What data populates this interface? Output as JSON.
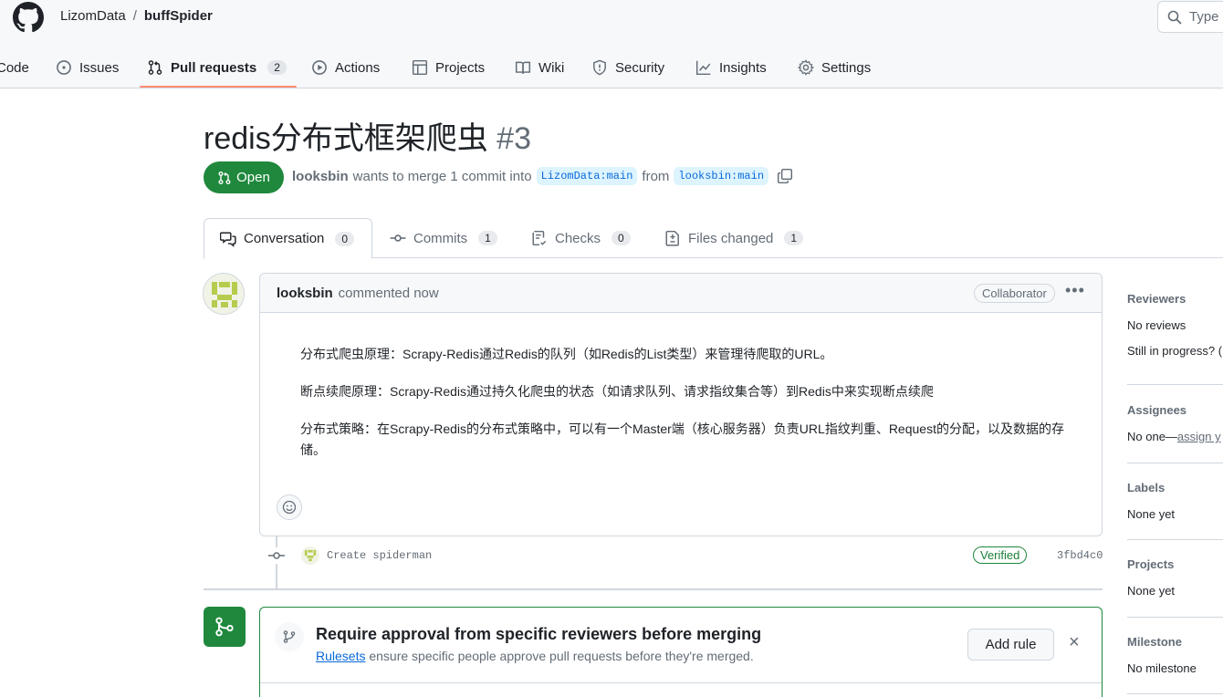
{
  "repo": {
    "owner": "LizomData",
    "separator": "/",
    "name": "buffSpider"
  },
  "search": {
    "placeholder": "Type"
  },
  "nav": {
    "code": "Code",
    "issues": "Issues",
    "pulls": "Pull requests",
    "pulls_count": "2",
    "actions": "Actions",
    "projects": "Projects",
    "wiki": "Wiki",
    "security": "Security",
    "insights": "Insights",
    "settings": "Settings"
  },
  "pr": {
    "title": "redis分布式框架爬虫",
    "number": "#3",
    "state": "Open",
    "author": "looksbin",
    "merge_text": "wants to merge 1 commit into",
    "base_branch": "LizomData:main",
    "from_text": "from",
    "head_branch": "looksbin:main"
  },
  "tabs": [
    {
      "label": "Conversation",
      "count": "0"
    },
    {
      "label": "Commits",
      "count": "1"
    },
    {
      "label": "Checks",
      "count": "0"
    },
    {
      "label": "Files changed",
      "count": "1"
    }
  ],
  "comment": {
    "author": "looksbin",
    "action": "commented now",
    "role": "Collaborator",
    "paragraphs": [
      "分布式爬虫原理：Scrapy-Redis通过Redis的队列（如Redis的List类型）来管理待爬取的URL。",
      "断点续爬原理：Scrapy-Redis通过持久化爬虫的状态（如请求队列、请求指纹集合等）到Redis中来实现断点续爬",
      "分布式策略：在Scrapy-Redis的分布式策略中，可以有一个Master端（核心服务器）负责URL指纹判重、Request的分配，以及数据的存储。"
    ]
  },
  "commit": {
    "message": "Create spiderman",
    "badge": "Verified",
    "sha": "3fbd4c0"
  },
  "merge_box": {
    "title": "Require approval from specific reviewers before merging",
    "desc_link": "Rulesets",
    "desc_rest": "ensure specific people approve pull requests before they're merged.",
    "button": "Add rule",
    "close": "×"
  },
  "sidebar": {
    "reviewers": {
      "heading": "Reviewers",
      "value": "No reviews",
      "extra": "Still in progress? ("
    },
    "assignees": {
      "heading": "Assignees",
      "value": "No one—",
      "link": "assign y"
    },
    "labels": {
      "heading": "Labels",
      "value": "None yet"
    },
    "projects": {
      "heading": "Projects",
      "value": "None yet"
    },
    "milestone": {
      "heading": "Milestone",
      "value": "No milestone"
    }
  },
  "colors": {
    "open_green": "#1f883d",
    "link_blue": "#0969da",
    "tab_underline": "#fd8c73"
  }
}
